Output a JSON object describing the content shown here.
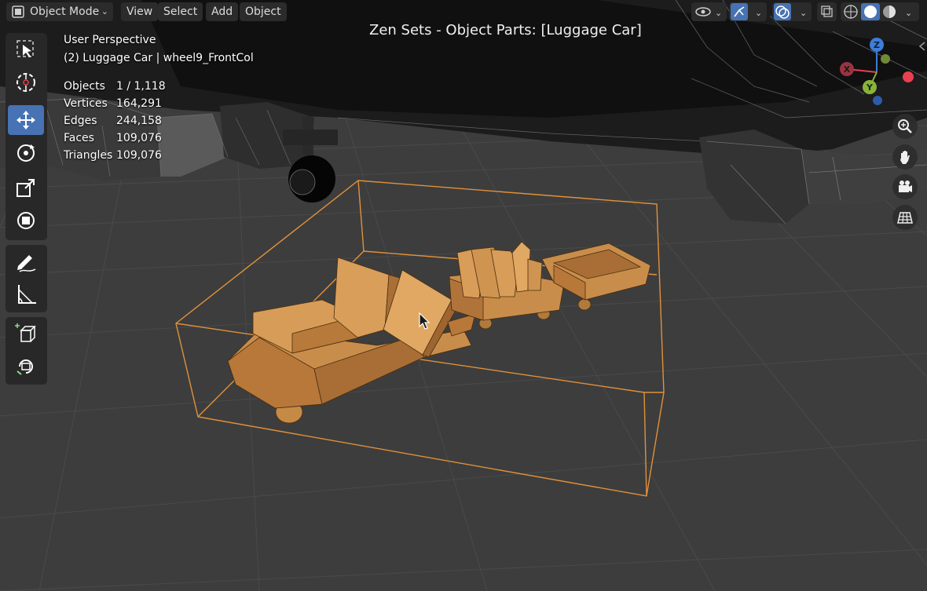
{
  "header": {
    "mode_label": "Object Mode",
    "menus": [
      "View",
      "Select",
      "Add",
      "Object"
    ],
    "title": "Zen Sets - Object Parts: [Luggage Car]"
  },
  "overlay": {
    "perspective": "User Perspective",
    "active_object": "(2) Luggage Car | wheel9_FrontCol",
    "stats": [
      {
        "label": "Objects",
        "value": "1 / 1,118"
      },
      {
        "label": "Vertices",
        "value": "164,291"
      },
      {
        "label": "Edges",
        "value": "244,158"
      },
      {
        "label": "Faces",
        "value": "109,076"
      },
      {
        "label": "Triangles",
        "value": "109,076"
      }
    ]
  },
  "toolbar": {
    "tools": [
      "select-box",
      "cursor",
      "move",
      "rotate",
      "scale",
      "transform",
      "annotate",
      "measure",
      "add-cube",
      "custom"
    ],
    "active_tool": "move"
  },
  "gizmo": {
    "axes": [
      "Z",
      "X",
      "Y"
    ],
    "colors": {
      "x": "#e8404f",
      "y": "#88b43a",
      "z": "#3c7ed8",
      "selection": "#e0913a",
      "active": "#4772b3"
    }
  },
  "navigation": [
    "zoom-icon",
    "hand-pan-icon",
    "camera-icon",
    "grid-ortho-icon"
  ]
}
